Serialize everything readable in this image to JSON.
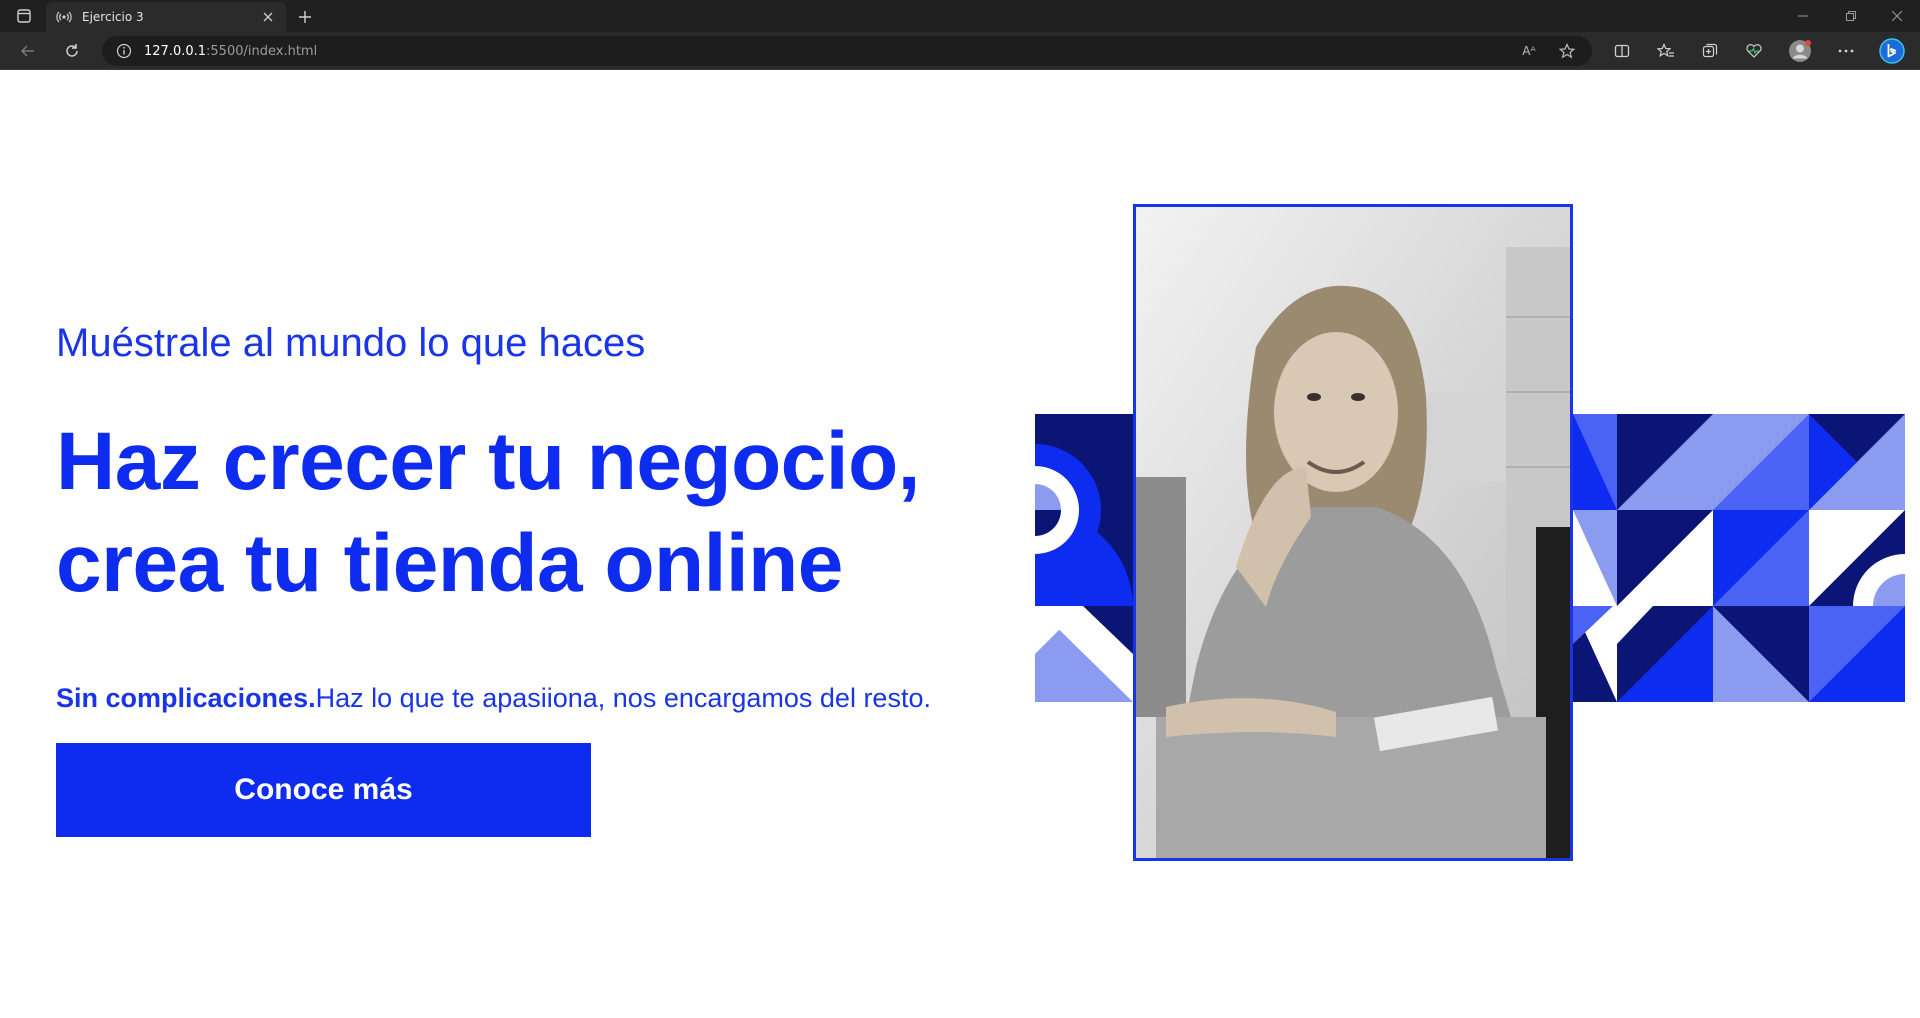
{
  "browser": {
    "tab_title": "Ejercicio 3",
    "url_host": "127.0.0.1",
    "url_rest": ":5500/index.html",
    "read_aloud_label": "Aᴬ"
  },
  "hero": {
    "subtitle": "Muéstrale al mundo lo que haces",
    "headline_line1": "Haz crecer tu negocio,",
    "headline_line2": "crea tu tienda online",
    "tagline_bold": "Sin complicaciones.",
    "tagline_rest": "Haz lo que te apasiiona, nos encargamos del resto.",
    "cta_label": "Conoce más"
  },
  "colors": {
    "brand_blue": "#0e2cf0",
    "navy": "#0a1575",
    "light_blue": "#8a9bf0",
    "mid_blue": "#4a63f5"
  },
  "icons": [
    "tab-actions-icon",
    "broadcast-icon",
    "close-icon",
    "plus-icon",
    "back-icon",
    "refresh-icon",
    "info-icon",
    "read-aloud-icon",
    "favorite-star-icon",
    "split-screen-icon",
    "favorites-icon",
    "collections-icon",
    "health-icon",
    "profile-icon",
    "more-icon",
    "bing-icon",
    "minimize-icon",
    "restore-icon",
    "window-close-icon"
  ]
}
